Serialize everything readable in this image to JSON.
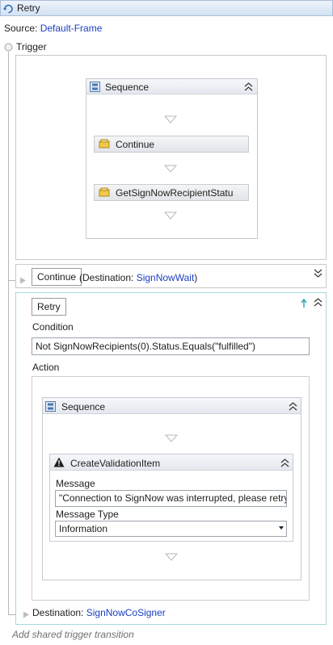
{
  "window": {
    "title": "Retry"
  },
  "source": {
    "label": "Source:",
    "value": "Default-Frame"
  },
  "trigger": {
    "label": "Trigger",
    "sequence": {
      "title": "Sequence",
      "activities": [
        "Continue",
        "GetSignNowRecipientStatu"
      ]
    }
  },
  "transition_continue": {
    "button_label": "Continue",
    "destination_prefix": "(Destination: ",
    "destination_value": "SignNowWait",
    "destination_suffix": ")"
  },
  "transition_retry": {
    "button_label": "Retry",
    "condition_label": "Condition",
    "condition_value": "Not SignNowRecipients(0).Status.Equals(\"fulfilled\")",
    "action_label": "Action",
    "sequence_title": "Sequence",
    "activity": {
      "title": "CreateValidationItem",
      "message_label": "Message",
      "message_value": "\"Connection to SignNow was interrupted, please retry.",
      "message_type_label": "Message Type",
      "message_type_value": "Information"
    },
    "destination_label": "Destination:",
    "destination_value": "SignNowCoSigner"
  },
  "footer": {
    "add_transition": "Add shared trigger transition"
  },
  "colors": {
    "link": "#1a3fbf",
    "accent_border": "#a8d8dc",
    "header_bg": "#dbe6f4"
  }
}
